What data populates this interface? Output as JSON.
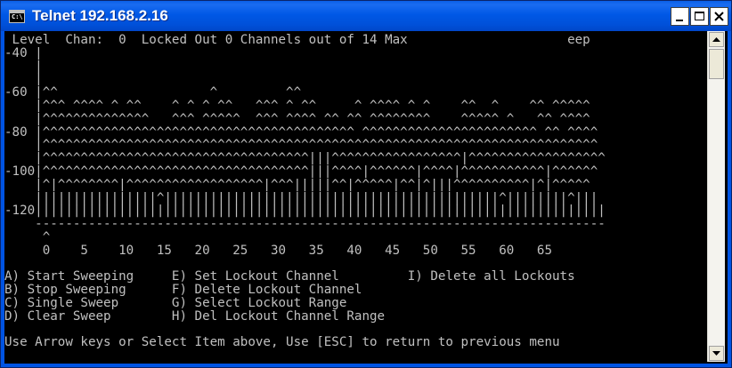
{
  "window": {
    "title": "Telnet 192.168.2.16",
    "icon": "cmd-prompt-icon",
    "icon_text": "C:\\",
    "controls": [
      "minimize-icon",
      "maximize-icon",
      "close-icon"
    ]
  },
  "screen": {
    "lines": [
      " Level  Chan:  0  Locked Out 0 Channels out of 14 Max                     eep",
      "-40 |",
      "    |",
      "    |",
      "-60 |^^                    ^         ^^",
      "    |^^^ ^^^^ ^ ^^    ^ ^ ^ ^^   ^^^ ^ ^^     ^ ^^^^ ^ ^    ^^  ^    ^^ ^^^^^",
      "    |^^^^^^^^^^^^^^   ^^^ ^^^^^  ^^^ ^^^^ ^^ ^^ ^^^^^^^^    ^^^^^ ^   ^^ ^^^^",
      "-80 |^^^^^^^^^^^^^^^^^^^^^^^^^^^^^^^^^^^^^^^^^ ^^^^^^^^^^^^^^^^^^^^^^^ ^^ ^^^^",
      "    |^^^^^^^^^^^^^^^^^^^^^^^^^^^^^^^^^^^^^^^^^^^^^^^^^^^^^^^^^^^^^^^^^^^^^^^^^",
      "    |^^^^^^^^^^^^^^^^^^^^^^^^^^^^^^^^^^^|||^^^^^^^^^^^^^^^^^|^^^^^^^^^^^^^^^^^^",
      "-100|^^^^^^^^^^^^^^^^^^^^^^^^^^^^^^^^^^^|||^^^^|^^^^^^|^^^^|^^^^^^^^^^^|^^^^^^",
      "    |^|^^^^^^^^|^^^^^^^^^^^^^^^^^^|^^^|||||^^|^^^^^|^^|^|||^^^^^^^^^^|^|^^^^^",
      "    ||||||||||||||||^||||||||||||||||||||||||||||||||||||||||||||^||||||||^|||",
      "-120|||||||||||||||||||||||||||||||||||||||||||||||||||||||||||||||||||||||||||",
      "    ---------------------------------------------------------------------------",
      "     ^",
      "     0    5    10   15   20   25   30   35   40   45   50   55   60   65",
      "",
      "A) Start Sweeping     E) Set Lockout Channel         I) Delete all Lockouts",
      "B) Stop Sweeping      F) Delete Lockout Channel",
      "C) Single Sweep       G) Select Lockout Range",
      "D) Clear Sweep        H) Del Lockout Channel Range",
      "",
      "Use Arrow keys or Select Item above, Use [ESC] to return to previous menu"
    ]
  },
  "colors": {
    "console_bg": "#000000",
    "console_fg": "#c0c0c0",
    "titlebar": "#0054e3"
  }
}
